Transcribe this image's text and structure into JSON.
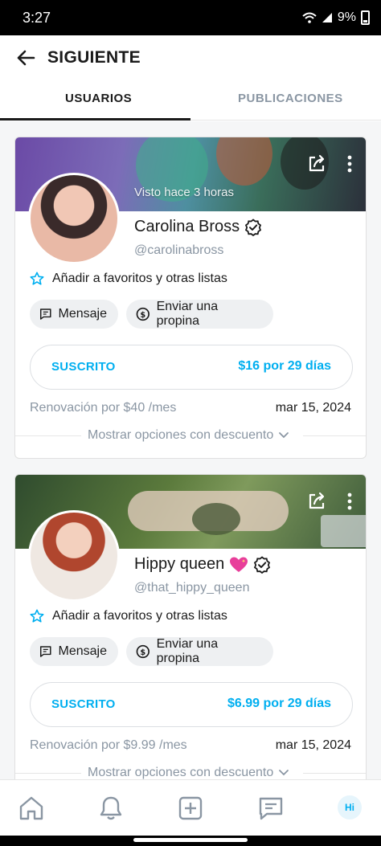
{
  "status_bar": {
    "time": "3:27",
    "battery": "9%"
  },
  "header": {
    "title": "SIGUIENTE"
  },
  "tabs": [
    {
      "label": "USUARIOS",
      "active": true
    },
    {
      "label": "PUBLICACIONES",
      "active": false
    }
  ],
  "cards": [
    {
      "banner_text": "Visto hace 3 horas",
      "name": "Carolina Bross",
      "handle": "@carolinabross",
      "favorites_label": "Añadir a favoritos y otras listas",
      "message_label": "Mensaje",
      "tip_label": "Enviar una propina",
      "subscribed_label": "SUSCRITO",
      "price_label": "$16 por 29 días",
      "renewal_label": "Renovación por $40 /mes",
      "renewal_date": "mar 15, 2024",
      "discount_label": "Mostrar opciones con descuento"
    },
    {
      "banner_text": "",
      "name": "Hippy queen",
      "handle": "@that_hippy_queen",
      "favorites_label": "Añadir a favoritos y otras listas",
      "message_label": "Mensaje",
      "tip_label": "Enviar una propina",
      "subscribed_label": "SUSCRITO",
      "price_label": "$6.99 por 29 días",
      "renewal_label": "Renovación por $9.99 /mes",
      "renewal_date": "mar 15, 2024",
      "discount_label": "Mostrar opciones con descuento"
    }
  ],
  "bottom_nav": {
    "items": [
      "home-icon",
      "bell-icon",
      "add-post-icon",
      "messages-icon"
    ],
    "avatar_initials": "Hi"
  },
  "colors": {
    "accent": "#00aff0",
    "muted": "#8a96a3",
    "text": "#1a1a1a"
  }
}
